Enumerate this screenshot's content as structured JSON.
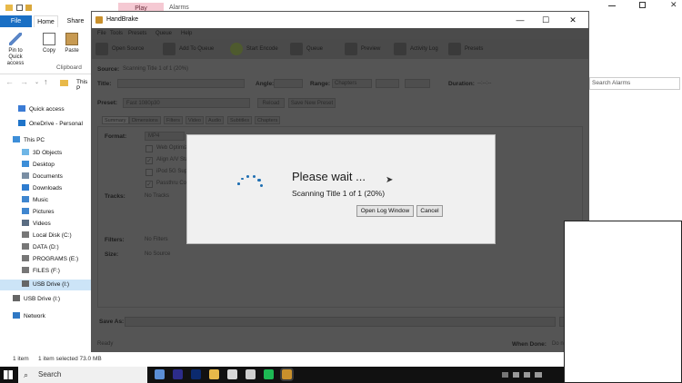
{
  "explorer": {
    "ribbon_tabs": [
      "File",
      "Home",
      "Share"
    ],
    "context_tab": "Play",
    "window_title": "Alarms",
    "ribbon_buttons": [
      "Pin to Quick access",
      "Copy",
      "Paste"
    ],
    "ribbon_group": "Clipboard",
    "address": "This P",
    "search_placeholder": "Search Alarms",
    "nav_items": [
      {
        "label": "Quick access",
        "icon": "star-icon"
      },
      {
        "label": "OneDrive - Personal",
        "icon": "cloud-icon"
      },
      {
        "label": "This PC",
        "icon": "computer-icon"
      },
      {
        "label": "3D Objects",
        "icon": "cube-icon"
      },
      {
        "label": "Desktop",
        "icon": "folder-icon"
      },
      {
        "label": "Documents",
        "icon": "documents-icon"
      },
      {
        "label": "Downloads",
        "icon": "download-icon"
      },
      {
        "label": "Music",
        "icon": "music-icon"
      },
      {
        "label": "Pictures",
        "icon": "pictures-icon"
      },
      {
        "label": "Videos",
        "icon": "videos-icon"
      },
      {
        "label": "Local Disk (C:)",
        "icon": "drive-icon"
      },
      {
        "label": "DATA (D:)",
        "icon": "drive-icon"
      },
      {
        "label": "PROGRAMS (E:)",
        "icon": "drive-icon"
      },
      {
        "label": "FILES (F:)",
        "icon": "drive-icon"
      },
      {
        "label": "USB Drive (I:)",
        "icon": "usb-drive-icon"
      },
      {
        "label": "USB Drive (I:)",
        "icon": "usb-drive-icon"
      },
      {
        "label": "Network",
        "icon": "network-icon"
      }
    ],
    "status_count": "1 item",
    "status_selected": "1 item selected  73.0 MB"
  },
  "taskbar": {
    "search_label": "Search",
    "icons": [
      "start-icon",
      "search-icon",
      "mail-icon",
      "chrome-icon",
      "photoshop-icon",
      "file-explorer-icon",
      "chrome-icon",
      "notepad-icon",
      "spotify-icon",
      "handbrake-icon"
    ]
  },
  "handbrake": {
    "title": "HandBrake",
    "menu": [
      "File",
      "Tools",
      "Presets",
      "Queue",
      "Help"
    ],
    "toolbar": [
      "Open Source",
      "Add To Queue",
      "Start Encode",
      "Queue",
      "Preview",
      "Activity Log",
      "Presets"
    ],
    "source_label": "Source:",
    "source_value": "Scanning Title 1 of 1 (20%)",
    "title_label": "Title:",
    "angle_label": "Angle:",
    "range_label": "Range:",
    "range_value": "Chapters",
    "duration_label": "Duration:",
    "duration_value": "--:--:--",
    "preset_label": "Preset:",
    "preset_value": "Fast 1080p30",
    "reload_label": "Reload",
    "save_preset_label": "Save New Preset",
    "tabs": [
      "Summary",
      "Dimensions",
      "Filters",
      "Video",
      "Audio",
      "Subtitles",
      "Chapters"
    ],
    "format_label": "Format:",
    "format_value": "MP4",
    "checkboxes": [
      "Web Optimized",
      "Align A/V Start",
      "iPod 5G Support",
      "Passthru Common Metadata"
    ],
    "tracks_label": "Tracks:",
    "tracks_value": "No Tracks",
    "filters_label": "Filters:",
    "filters_value": "No Filters",
    "size_label": "Size:",
    "size_value": "No Source",
    "save_as_label": "Save As:",
    "status_text": "Ready",
    "when_done_label": "When Done:",
    "when_done_value": "Do nothing"
  },
  "dialog": {
    "title": "Please wait ...",
    "message": "Scanning Title 1 of 1 (20%)",
    "progress": 0.2,
    "log_button": "Open Log Window",
    "cancel_button": "Cancel"
  }
}
